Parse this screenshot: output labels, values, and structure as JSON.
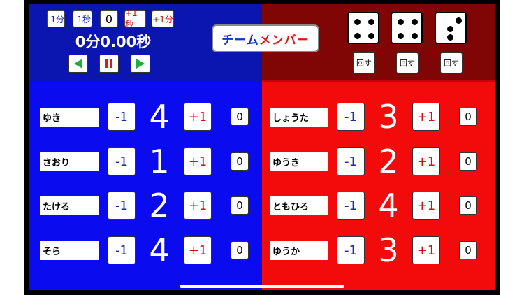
{
  "timer_controls": {
    "minus_min": "-1分",
    "minus_sec": "-1秒",
    "counter": "0",
    "plus_sec": "+1秒",
    "plus_min": "+1分"
  },
  "timer": {
    "display": "0分0.00秒"
  },
  "team_button": {
    "part1": "チーム",
    "part2": "メンバー"
  },
  "dice": {
    "values": [
      4,
      4,
      3
    ],
    "roll_label": "回す"
  },
  "blue_team": {
    "color": "#0b0bf0",
    "players": [
      {
        "name": "ゆき",
        "score": "4"
      },
      {
        "name": "さおり",
        "score": "1"
      },
      {
        "name": "たける",
        "score": "2"
      },
      {
        "name": "そら",
        "score": "4"
      }
    ]
  },
  "red_team": {
    "color": "#f30b0b",
    "players": [
      {
        "name": "しょうた",
        "score": "3"
      },
      {
        "name": "ゆうき",
        "score": "2"
      },
      {
        "name": "ともひろ",
        "score": "4"
      },
      {
        "name": "ゆうか",
        "score": "3"
      }
    ]
  },
  "controls": {
    "minus": "-1",
    "plus": "+1",
    "reset": "0"
  }
}
